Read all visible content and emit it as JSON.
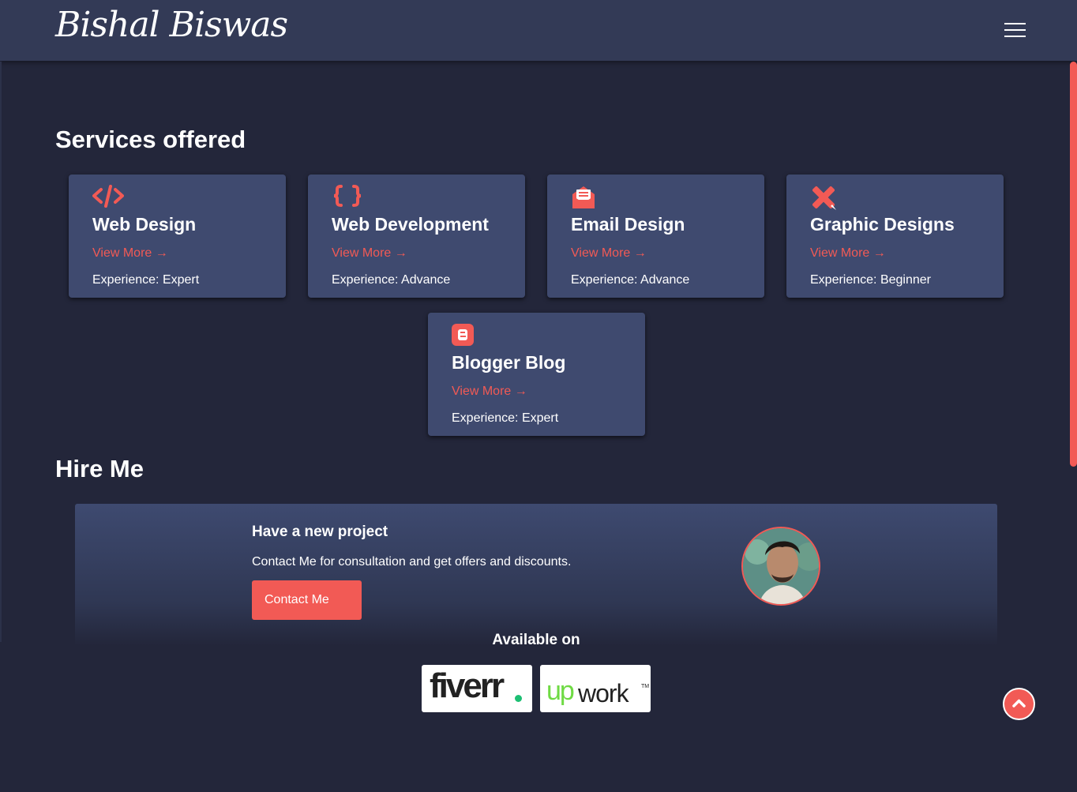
{
  "navbar": {
    "brand": "Bishal Biswas",
    "menu_icon": "hamburger-menu-icon"
  },
  "services": {
    "heading": "Services offered",
    "view_more_label": "View More",
    "cards": [
      {
        "icon": "code-icon",
        "title": "Web Design",
        "view_more": "View More",
        "experience": "Experience: Expert"
      },
      {
        "icon": "curly-braces-icon",
        "title": "Web Development",
        "view_more": "View More",
        "experience": "Experience: Advance"
      },
      {
        "icon": "envelope-open-text-icon",
        "title": "Email Design",
        "view_more": "View More",
        "experience": "Experience: Advance"
      },
      {
        "icon": "pencil-ruler-icon",
        "title": "Graphic Designs",
        "view_more": "View More",
        "experience": "Experience: Beginner"
      },
      {
        "icon": "blogger-icon",
        "title": "Blogger Blog",
        "view_more": "View More",
        "experience": "Experience: Expert"
      }
    ]
  },
  "hire": {
    "heading": "Hire Me",
    "title": "Have a new project",
    "text": "Contact Me for consultation and get offers and discounts.",
    "button": "Contact Me",
    "avatar_icon": "profile-avatar"
  },
  "available": {
    "label": "Available on",
    "platforms": [
      {
        "name": "fiverr",
        "logo_text": "fiverr"
      },
      {
        "name": "upwork",
        "logo_up": "up",
        "logo_work": "work",
        "logo_tm": "TM"
      }
    ]
  },
  "colors": {
    "accent": "#f25a55",
    "background": "#23263a",
    "card": "#3f4a6f",
    "navbar": "#333a56",
    "fiverr_green": "#1dbf73",
    "upwork_green": "#6fda44"
  },
  "back_to_top_icon": "chevron-up-icon"
}
